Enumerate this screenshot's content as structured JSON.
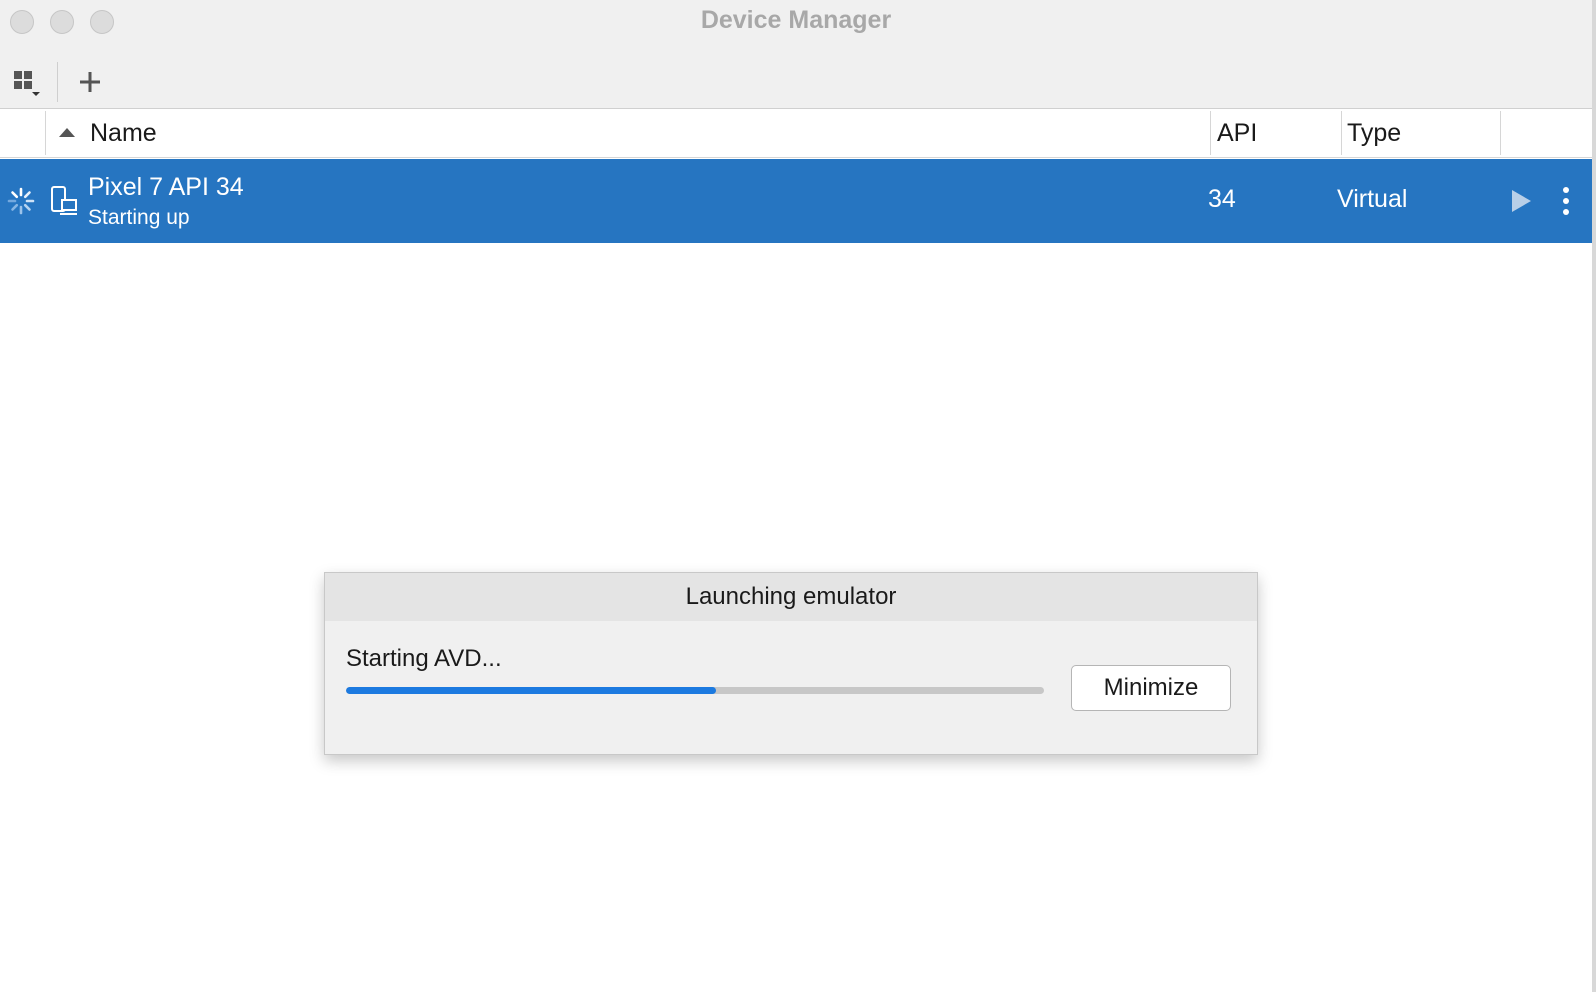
{
  "window": {
    "title": "Device Manager"
  },
  "toolbar": {
    "items": [
      {
        "icon": "grid-menu-icon"
      },
      {
        "icon": "plus-icon"
      }
    ]
  },
  "table": {
    "columns": [
      "Name",
      "API",
      "Type"
    ],
    "sort": {
      "column": "Name",
      "direction": "ascending"
    },
    "rows": [
      {
        "name": "Pixel 7 API 34",
        "status": "Starting up",
        "api": "34",
        "type": "Virtual",
        "selected": true,
        "icons": [
          "loading-spinner-icon",
          "device-icon",
          "play-icon",
          "more-vert-icon"
        ]
      }
    ]
  },
  "dialog": {
    "title": "Launching emulator",
    "message": "Starting AVD...",
    "progress": 0.53,
    "button": "Minimize"
  },
  "colors": {
    "selection": "#2675c1",
    "progress_fill": "#1c7ae0",
    "progress_track": "#c7c7c7",
    "chrome": "#f0f0f0"
  }
}
